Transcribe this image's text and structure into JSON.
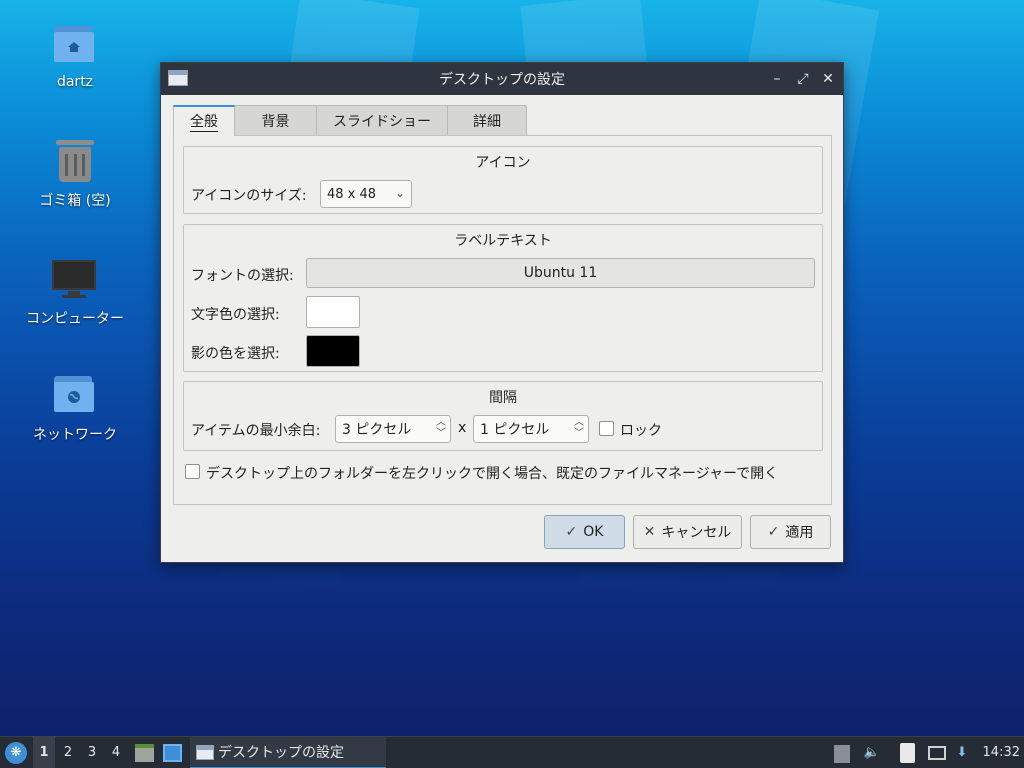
{
  "desktop": {
    "icons": [
      {
        "label": "dartz",
        "type": "home-folder"
      },
      {
        "label": "ゴミ箱 (空)",
        "type": "trash"
      },
      {
        "label": "コンピューター",
        "type": "computer"
      },
      {
        "label": "ネットワーク",
        "type": "network-folder"
      }
    ]
  },
  "window": {
    "title": "デスクトップの設定",
    "controls": {
      "minimize": "–",
      "maximize": "⤢",
      "close": "✕"
    },
    "tabs": [
      {
        "label": "全般",
        "active": true
      },
      {
        "label": "背景",
        "active": false
      },
      {
        "label": "スライドショー",
        "active": false
      },
      {
        "label": "詳細",
        "active": false
      }
    ],
    "icon_group": {
      "title": "アイコン",
      "size_label": "アイコンのサイズ:",
      "size_value": "48 x 48"
    },
    "label_group": {
      "title": "ラベルテキスト",
      "font_label": "フォントの選択:",
      "font_value": "Ubuntu 11",
      "text_color_label": "文字色の選択:",
      "text_color": "#ffffff",
      "shadow_color_label": "影の色を選択:",
      "shadow_color": "#000000"
    },
    "spacing_group": {
      "title": "間隔",
      "min_margin_label": "アイテムの最小余白:",
      "margin_x_value": "3 ピクセル",
      "separator": "x",
      "margin_y_value": "1 ピクセル",
      "lock_label": "ロック",
      "lock_checked": false
    },
    "open_folder_option": {
      "label": "デスクトップ上のフォルダーを左クリックで開く場合、既定のファイルマネージャーで開く",
      "checked": false
    },
    "buttons": {
      "ok": "OK",
      "cancel": "キャンセル",
      "apply": "適用"
    }
  },
  "taskbar": {
    "start_icon": "start-menu-icon",
    "desktops": [
      "1",
      "2",
      "3",
      "4"
    ],
    "active_desktop": "1",
    "task_label": "デスクトップの設定",
    "clock": "14:32"
  },
  "colors": {
    "accent": "#3f8fd6",
    "titlebar": "#2e3440",
    "taskbar": "#262c36"
  }
}
